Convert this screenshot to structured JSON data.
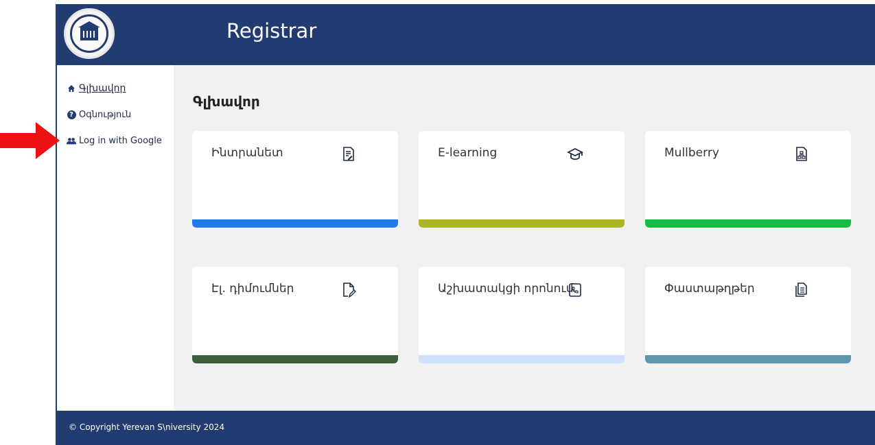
{
  "header": {
    "title": "Registrar"
  },
  "sidebar": {
    "items": [
      {
        "label": "Գլխավոր",
        "icon": "home-icon",
        "active": true
      },
      {
        "label": "Օգնություն",
        "icon": "help-icon",
        "active": false
      },
      {
        "label": "Log in with Google",
        "icon": "users-icon",
        "active": false
      }
    ]
  },
  "main": {
    "page_title": "Գլխավոր",
    "cards": [
      {
        "label": "Ինտրանետ",
        "icon": "document-edit-icon",
        "bar_color": "#1f7ae8"
      },
      {
        "label": "E-learning",
        "icon": "graduation-cap-icon",
        "bar_color": "#aab826"
      },
      {
        "label": "Mullberry",
        "icon": "document-sitemap-icon",
        "bar_color": "#18bb46"
      },
      {
        "label": "Էլ. դիմումներ",
        "icon": "file-pen-icon",
        "bar_color": "#3e5f3d"
      },
      {
        "label": "Աշխատակցի որոնում",
        "icon": "phone-file-icon",
        "bar_color": "#cfe0fc"
      },
      {
        "label": "Փաստաթղթեր",
        "icon": "copy-document-icon",
        "bar_color": "#5e97ad"
      }
    ]
  },
  "footer": {
    "copyright": "© Copyright Yerevan S\\niversity 2024"
  },
  "colors": {
    "navy": "#223b71",
    "background": "#f1f1f1",
    "annotation_arrow": "#ee1111"
  }
}
